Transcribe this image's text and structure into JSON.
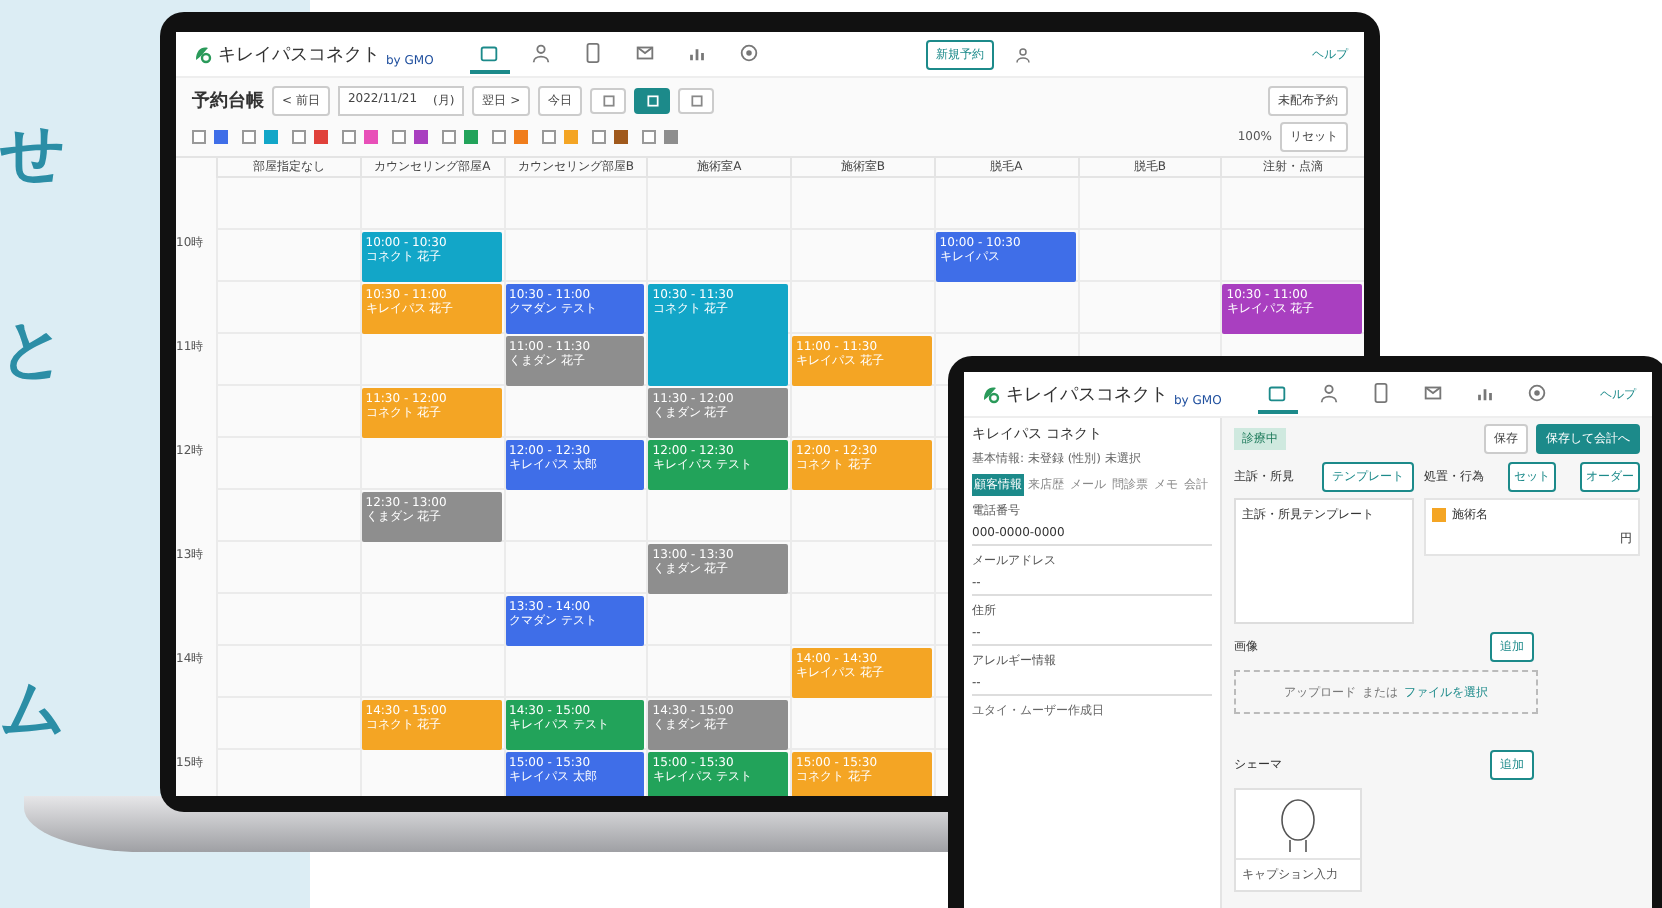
{
  "side_text": [
    "せ",
    "と",
    "ム"
  ],
  "laptop": {
    "brand": "キレイパスコネクト",
    "brand_sub": "by GMO",
    "nav": [
      {
        "selected": true
      },
      {
        "selected": false
      },
      {
        "selected": false
      },
      {
        "selected": false
      },
      {
        "selected": false
      },
      {
        "selected": false
      }
    ],
    "new_button": "新規予約",
    "help": "ヘルプ",
    "title": "予約台帳",
    "prev": "< 前日",
    "date": "2022/11/21",
    "weekday": "(月)",
    "next": "翌日 >",
    "today": "今日",
    "views": [
      {
        "selected": false
      },
      {
        "selected": true
      },
      {
        "selected": false
      }
    ],
    "unassigned_button": "未配布予約",
    "zoom": "100%",
    "reset": "リセット",
    "filters": [
      {
        "color": "#3f6ee8",
        "checked": false
      },
      {
        "color": "#12a6c8",
        "checked": false
      },
      {
        "color": "#e0413a",
        "checked": false
      },
      {
        "color": "#e84fb8",
        "checked": false
      },
      {
        "color": "#a93fc0",
        "checked": false
      },
      {
        "color": "#22a35a",
        "checked": false
      },
      {
        "color": "#f07d1c",
        "checked": false
      },
      {
        "color": "#f4a524",
        "checked": false
      },
      {
        "color": "#a0591c",
        "checked": false
      },
      {
        "color": "#8e8e8e",
        "checked": false
      }
    ],
    "hours": [
      "10時",
      "11時",
      "12時",
      "13時",
      "14時",
      "15時"
    ],
    "columns": [
      {
        "name": "部屋指定なし"
      },
      {
        "name": "カウンセリング部屋A",
        "events": [
          {
            "time": "10:00 - 10:30",
            "name": "コネクト 花子",
            "color": "#12a6c8"
          },
          {
            "time": "10:30 - 11:00",
            "name": "キレイパス 花子",
            "color": "#f4a524"
          },
          {
            "time": "11:30 - 12:00",
            "name": "コネクト 花子",
            "color": "#f4a524"
          },
          {
            "time": "12:30 - 13:00",
            "name": "くまダン 花子",
            "color": "#8e8e8e"
          },
          {
            "time": "14:30 - 15:00",
            "name": "コネクト 花子",
            "color": "#f4a524"
          }
        ]
      },
      {
        "name": "カウンセリング部屋B",
        "events": [
          {
            "time": "10:30 - 11:00",
            "name": "クマダン テスト",
            "color": "#3f6ee8"
          },
          {
            "time": "11:00 - 11:30",
            "name": "くまダン 花子",
            "color": "#8e8e8e"
          },
          {
            "time": "12:00 - 12:30",
            "name": "キレイパス 太郎",
            "color": "#3f6ee8"
          },
          {
            "time": "13:30 - 14:00",
            "name": "クマダン テスト",
            "color": "#3f6ee8"
          },
          {
            "time": "14:30 - 15:00",
            "name": "キレイパス テスト",
            "color": "#22a35a"
          },
          {
            "time": "15:00 - 15:30",
            "name": "キレイパス 太郎",
            "color": "#3f6ee8"
          }
        ]
      },
      {
        "name": "施術室A",
        "events": [
          {
            "time": "10:30 - 11:30",
            "name": "コネクト 花子",
            "color": "#12a6c8"
          },
          {
            "time": "11:30 - 12:00",
            "name": "くまダン 花子",
            "color": "#8e8e8e"
          },
          {
            "time": "12:00 - 12:30",
            "name": "キレイパス テスト",
            "color": "#22a35a"
          },
          {
            "time": "13:00 - 13:30",
            "name": "くまダン 花子",
            "color": "#8e8e8e"
          },
          {
            "time": "14:30 - 15:00",
            "name": "くまダン 花子",
            "color": "#8e8e8e"
          },
          {
            "time": "15:00 - 15:30",
            "name": "キレイパス テスト",
            "color": "#22a35a"
          }
        ]
      },
      {
        "name": "施術室B",
        "events": [
          {
            "time": "11:00 - 11:30",
            "name": "キレイパス 花子",
            "color": "#f4a524"
          },
          {
            "time": "12:00 - 12:30",
            "name": "コネクト 花子",
            "color": "#f4a524"
          },
          {
            "time": "14:00 - 14:30",
            "name": "キレイパス 花子",
            "color": "#f4a524"
          },
          {
            "time": "15:00 - 15:30",
            "name": "コネクト 花子",
            "color": "#f4a524"
          }
        ]
      },
      {
        "name": "脱毛A",
        "events": [
          {
            "time": "10:00 - 10:30",
            "name": "キレイパス",
            "color": "#3f6ee8"
          }
        ]
      },
      {
        "name": "脱毛B"
      },
      {
        "name": "注射・点滴",
        "events": [
          {
            "time": "10:30 - 11:00",
            "name": "キレイパス 花子",
            "color": "#a93fc0"
          }
        ]
      }
    ]
  },
  "tablet": {
    "brand": "キレイパスコネクト",
    "brand_sub": "by GMO",
    "nav": [
      {
        "selected": true
      },
      {
        "selected": false
      },
      {
        "selected": false
      },
      {
        "selected": false
      },
      {
        "selected": false
      },
      {
        "selected": false
      }
    ],
    "help": "ヘルプ",
    "patient": "キレイパス コネクト",
    "patient_info": "基本情報: 未登録 (性別) 未選択",
    "tabs": [
      {
        "label": "顧客情報",
        "selected": true
      },
      {
        "label": "来店歴",
        "selected": false
      },
      {
        "label": "メール",
        "selected": false
      },
      {
        "label": "問診票",
        "selected": false
      },
      {
        "label": "メモ",
        "selected": false
      },
      {
        "label": "会計",
        "selected": false
      }
    ],
    "fields": [
      {
        "label": "電話番号",
        "value": "000-0000-0000"
      },
      {
        "label": "メールアドレス",
        "value": "--"
      },
      {
        "label": "住所",
        "value": "--"
      },
      {
        "label": "アレルギー情報",
        "value": "--"
      }
    ],
    "field_note": "ユタイ・ムーザー作成日",
    "status": "診療中",
    "save": "保存",
    "save_checkout": "保存して会計へ",
    "complaint_label": "主訴・所見",
    "template_button": "テンプレート",
    "complaint_value": "主訴・所見テンプレート",
    "treatment_label": "処置・行為",
    "set_button": "セット",
    "order_button": "オーダー",
    "treatment_item": "施術名",
    "yen": "円",
    "image_label": "画像",
    "add": "追加",
    "upload": "アップロード",
    "upload_or": "または",
    "upload_select": "ファイルを選択",
    "schema_label": "シェーマ",
    "schema_add": "追加",
    "caption": "キャプション入力"
  }
}
